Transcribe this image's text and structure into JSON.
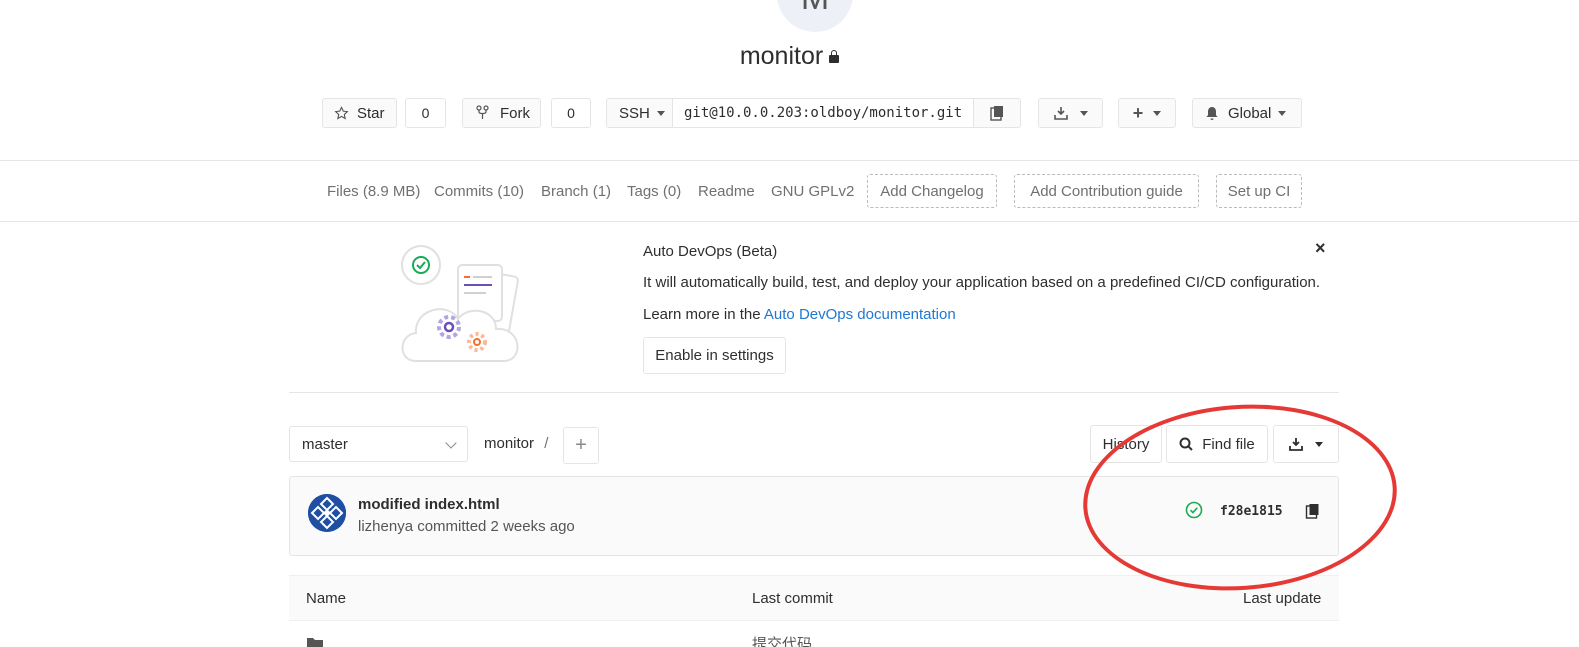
{
  "project": {
    "avatar_letter": "M",
    "name": "monitor"
  },
  "actions": {
    "star_label": "Star",
    "star_count": "0",
    "fork_label": "Fork",
    "fork_count": "0",
    "protocol": "SSH",
    "clone_url": "git@10.0.0.203:oldboy/monitor.git",
    "notification": "Global"
  },
  "nav": {
    "files": "Files (8.9 MB)",
    "commits": "Commits (10)",
    "branch": "Branch (1)",
    "tags": "Tags (0)",
    "readme": "Readme",
    "license": "GNU GPLv2",
    "add_changelog": "Add Changelog",
    "add_contribution": "Add Contribution guide",
    "setup_ci": "Set up CI"
  },
  "devops": {
    "title": "Auto DevOps (Beta)",
    "text": "It will automatically build, test, and deploy your application based on a predefined CI/CD configuration.",
    "learn_prefix": "Learn more in the ",
    "learn_link": "Auto DevOps documentation",
    "enable_button": "Enable in settings",
    "close": "×"
  },
  "repo": {
    "branch": "master",
    "path": "monitor",
    "separator": "/",
    "history": "History",
    "find_file": "Find file"
  },
  "commit": {
    "title": "modified index.html",
    "meta": "lizhenya committed 2 weeks ago",
    "sha": "f28e1815"
  },
  "table": {
    "col_name": "Name",
    "col_last_commit": "Last commit",
    "col_last_update": "Last update",
    "row_commit": "提交代码"
  },
  "colors": {
    "link": "#1f78d1",
    "success": "#1aaa55",
    "annotation": "#e53935"
  }
}
